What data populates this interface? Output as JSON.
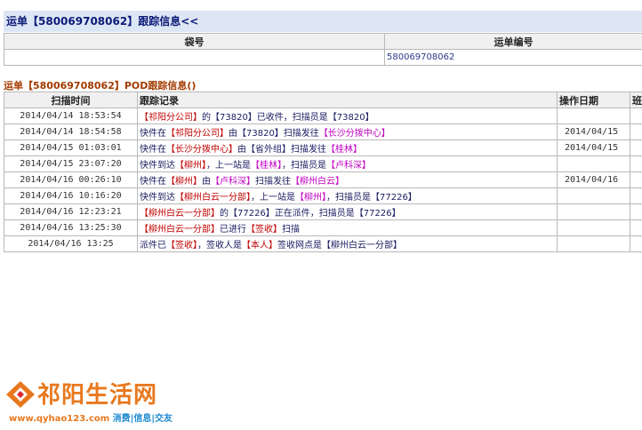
{
  "section1": {
    "title": "运单【580069708062】跟踪信息<<",
    "col_bag": "袋号",
    "col_waybill": "运单编号",
    "bag_value": "",
    "waybill_value": "580069708062"
  },
  "section2": {
    "title": "运单【580069708062】POD跟踪信息()",
    "headers": [
      "扫描时间",
      "跟踪记录",
      "操作日期",
      "班"
    ],
    "rows": [
      {
        "time": "2014/04/14 18:53:54",
        "date": "",
        "parts": [
          [
            "【祁阳分公司】",
            "r"
          ],
          [
            "的",
            "n"
          ],
          [
            "【73820】",
            "n"
          ],
          [
            "已收件，扫描员是",
            "n"
          ],
          [
            "【73820】",
            "n"
          ]
        ]
      },
      {
        "time": "2014/04/14 18:54:58",
        "date": "2014/04/15",
        "parts": [
          [
            "快件在",
            "n"
          ],
          [
            "【祁阳分公司】",
            "r"
          ],
          [
            "由",
            "n"
          ],
          [
            "【73820】",
            "n"
          ],
          [
            "扫描发往",
            "n"
          ],
          [
            "【长沙分拨中心】",
            "m"
          ]
        ]
      },
      {
        "time": "2014/04/15 01:03:01",
        "date": "2014/04/15",
        "parts": [
          [
            "快件在",
            "n"
          ],
          [
            "【长沙分拨中心】",
            "r"
          ],
          [
            "由",
            "n"
          ],
          [
            "【省外组】",
            "n"
          ],
          [
            "扫描发往",
            "n"
          ],
          [
            "【桂林】",
            "m"
          ]
        ]
      },
      {
        "time": "2014/04/15 23:07:20",
        "date": "",
        "parts": [
          [
            "快件到达",
            "n"
          ],
          [
            "【柳州】",
            "r"
          ],
          [
            "，上一站是",
            "n"
          ],
          [
            "【桂林】",
            "m"
          ],
          [
            "，扫描员是",
            "n"
          ],
          [
            "【卢科深】",
            "m"
          ]
        ]
      },
      {
        "time": "2014/04/16 00:26:10",
        "date": "2014/04/16",
        "parts": [
          [
            "快件在",
            "n"
          ],
          [
            "【柳州】",
            "r"
          ],
          [
            "由",
            "n"
          ],
          [
            "【卢科深】",
            "m"
          ],
          [
            "扫描发往",
            "n"
          ],
          [
            "【柳州白云】",
            "m"
          ]
        ]
      },
      {
        "time": "2014/04/16 10:16:20",
        "date": "",
        "parts": [
          [
            "快件到达",
            "n"
          ],
          [
            "【柳州白云一分部】",
            "r"
          ],
          [
            "，上一站是",
            "n"
          ],
          [
            "【柳州】",
            "m"
          ],
          [
            "，扫描员是",
            "n"
          ],
          [
            "【77226】",
            "n"
          ]
        ]
      },
      {
        "time": "2014/04/16 12:23:21",
        "date": "",
        "parts": [
          [
            "【柳州白云一分部】",
            "r"
          ],
          [
            "的",
            "n"
          ],
          [
            "【77226】",
            "n"
          ],
          [
            "正在派件，扫描员是",
            "n"
          ],
          [
            "【77226】",
            "n"
          ]
        ]
      },
      {
        "time": "2014/04/16 13:25:30",
        "date": "",
        "parts": [
          [
            "【柳州白云一分部】",
            "r"
          ],
          [
            "已进行",
            "n"
          ],
          [
            "【签收】",
            "r"
          ],
          [
            "扫描",
            "n"
          ]
        ]
      },
      {
        "time": "2014/04/16 13:25",
        "date": "",
        "parts": [
          [
            "派件已",
            "n"
          ],
          [
            "【签收】",
            "r"
          ],
          [
            "，签收人是",
            "n"
          ],
          [
            "【本人】",
            "r"
          ],
          [
            "签收网点是",
            "n"
          ],
          [
            "【柳州白云一分部】",
            "n"
          ]
        ]
      }
    ]
  },
  "logo": {
    "name": "祁阳生活网",
    "url": "www.qyhao123.com",
    "tagline_1": "消费",
    "tagline_2": "信息",
    "tagline_3": "交友",
    "brand_color": "#e8781e",
    "accent_color": "#1e8ad0"
  }
}
